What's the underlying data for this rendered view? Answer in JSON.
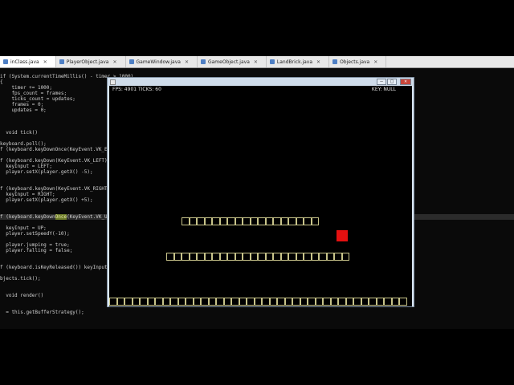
{
  "ide": {
    "tabs": [
      {
        "label": "inClass.java",
        "active": true
      },
      {
        "label": "PlayerObject.java",
        "active": false
      },
      {
        "label": "GameWindow.java",
        "active": false
      },
      {
        "label": "GameObject.java",
        "active": false
      },
      {
        "label": "LandBrick.java",
        "active": false
      },
      {
        "label": "Objects.java",
        "active": false
      }
    ],
    "tab_close_glyph": "✕",
    "code_lines": [
      "if (System.currentTimeMillis() - timer > 1000)",
      "{",
      "    timer += 1000;",
      "    fps_count = frames;",
      "    ticks_count = updates;",
      "    frames = 0;",
      "    updates = 0;",
      "",
      "",
      "",
      "  void tick()",
      "",
      "keyboard.poll();",
      "f (keyboard.keyDownOnce(KeyEvent.VK_ESCA",
      "",
      "f (keyboard.keyDown(KeyEvent.VK_LEFT)) {",
      "  keyInput = LEFT;",
      "  player.setX(player.getX() -5);",
      "",
      "",
      "f (keyboard.keyDown(KeyEvent.VK_RIGHT))",
      "  keyInput = RIGHT;",
      "  player.setX(player.getX() +5);",
      "",
      "",
      "f (keyboard.keyDownOnce(KeyEvent.VK_UP)",
      "",
      "  keyInput = UP;",
      "  player.setSpeedY(-10);",
      "",
      "  player.jumping = true;",
      "  player.falling = false;",
      "",
      "",
      "f (keyboard.isKeyReleased()) keyInput =",
      "",
      "bjects.tick();",
      "",
      "",
      "  void render()",
      "",
      "",
      "  = this.getBufferStrategy();"
    ],
    "highlighted_line": 25,
    "selection_text": "Once"
  },
  "game_window": {
    "fps_text": "FPS: 4901 TICKS: 60",
    "key_text": "KEY: NULL",
    "buttons": {
      "minimize": "–",
      "maximize": "□",
      "close": "✕"
    },
    "platforms": [
      {
        "name": "upper-platform",
        "bricks": 18
      },
      {
        "name": "lower-platform",
        "bricks": 24
      },
      {
        "name": "ground-platform",
        "bricks": 39
      }
    ],
    "colors": {
      "player": "#e41010",
      "brick_outline": "#c8c48a",
      "canvas_bg": "#000000"
    }
  }
}
